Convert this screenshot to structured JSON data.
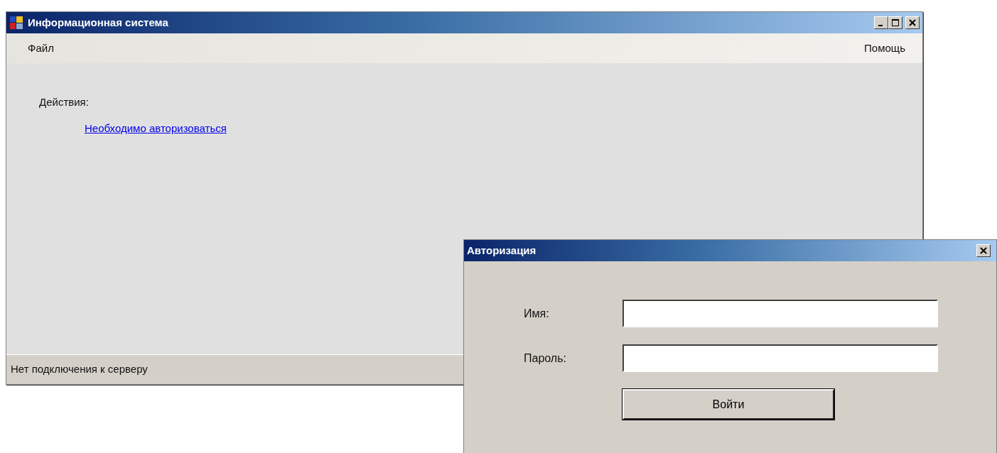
{
  "main_window": {
    "title": "Информационная система",
    "menu": [
      {
        "label": "Файл"
      },
      {
        "label": "Помощь"
      }
    ],
    "section_label": "Действия:",
    "link": "Необходимо авторизоваться",
    "status_bar": "Нет подключения к серверу"
  },
  "dialog": {
    "title": "Авторизация",
    "fields": [
      {
        "label": "Имя:"
      },
      {
        "label": "Пароль:"
      }
    ],
    "button": "Войти"
  }
}
